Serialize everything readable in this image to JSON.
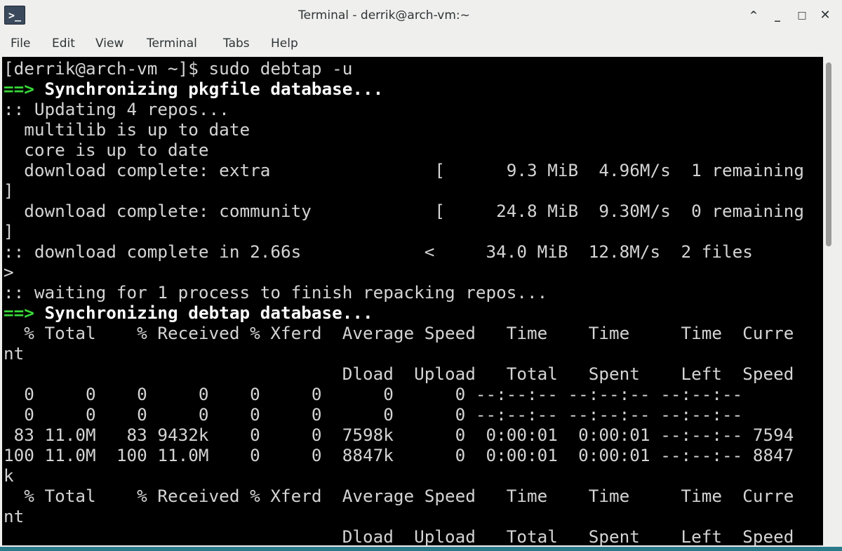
{
  "window": {
    "title": "Terminal - derrik@arch-vm:~",
    "app_icon_glyph": ">_",
    "controls": {
      "maximize": "^",
      "minimize": "_",
      "restore": "□",
      "close": "✕"
    }
  },
  "menubar": {
    "items": [
      "File",
      "Edit",
      "View",
      "Terminal",
      "Tabs",
      "Help"
    ]
  },
  "terminal": {
    "colors": {
      "background": "#000000",
      "foreground": "#d4d4d4",
      "arrow": "#38d838"
    },
    "lines": [
      {
        "prefix": "",
        "text": "[derrik@arch-vm ~]$ sudo debtap -u"
      },
      {
        "prefix": "==>",
        "text": " Synchronizing pkgfile database..."
      },
      {
        "prefix": "",
        "text": ":: Updating 4 repos..."
      },
      {
        "prefix": "",
        "text": "  multilib is up to date"
      },
      {
        "prefix": "",
        "text": "  core is up to date"
      },
      {
        "prefix": "",
        "text": "  download complete: extra                [      9.3 MiB  4.96M/s  1 remaining"
      },
      {
        "prefix": "",
        "text": "]"
      },
      {
        "prefix": "",
        "text": "  download complete: community            [     24.8 MiB  9.30M/s  0 remaining"
      },
      {
        "prefix": "",
        "text": "]"
      },
      {
        "prefix": "",
        "text": ":: download complete in 2.66s            <     34.0 MiB  12.8M/s  2 files"
      },
      {
        "prefix": "",
        "text": ">"
      },
      {
        "prefix": "",
        "text": ":: waiting for 1 process to finish repacking repos..."
      },
      {
        "prefix": "==>",
        "text": " Synchronizing debtap database..."
      },
      {
        "prefix": "",
        "text": "  % Total    % Received % Xferd  Average Speed   Time    Time     Time  Curre"
      },
      {
        "prefix": "",
        "text": "nt"
      },
      {
        "prefix": "",
        "text": "                                 Dload  Upload   Total   Spent    Left  Speed"
      },
      {
        "prefix": "",
        "text": "  0     0    0     0    0     0      0      0 --:--:-- --:--:-- --:--:--"
      },
      {
        "prefix": "",
        "text": "  0     0    0     0    0     0      0      0 --:--:-- --:--:-- --:--:--"
      },
      {
        "prefix": "",
        "text": " 83 11.0M   83 9432k    0     0  7598k      0  0:00:01  0:00:01 --:--:-- 7594"
      },
      {
        "prefix": "",
        "text": "100 11.0M  100 11.0M    0     0  8847k      0  0:00:01  0:00:01 --:--:-- 8847"
      },
      {
        "prefix": "",
        "text": "k"
      },
      {
        "prefix": "",
        "text": "  % Total    % Received % Xferd  Average Speed   Time    Time     Time  Curre"
      },
      {
        "prefix": "",
        "text": "nt"
      },
      {
        "prefix": "",
        "text": "                                 Dload  Upload   Total   Spent    Left  Speed"
      }
    ]
  }
}
